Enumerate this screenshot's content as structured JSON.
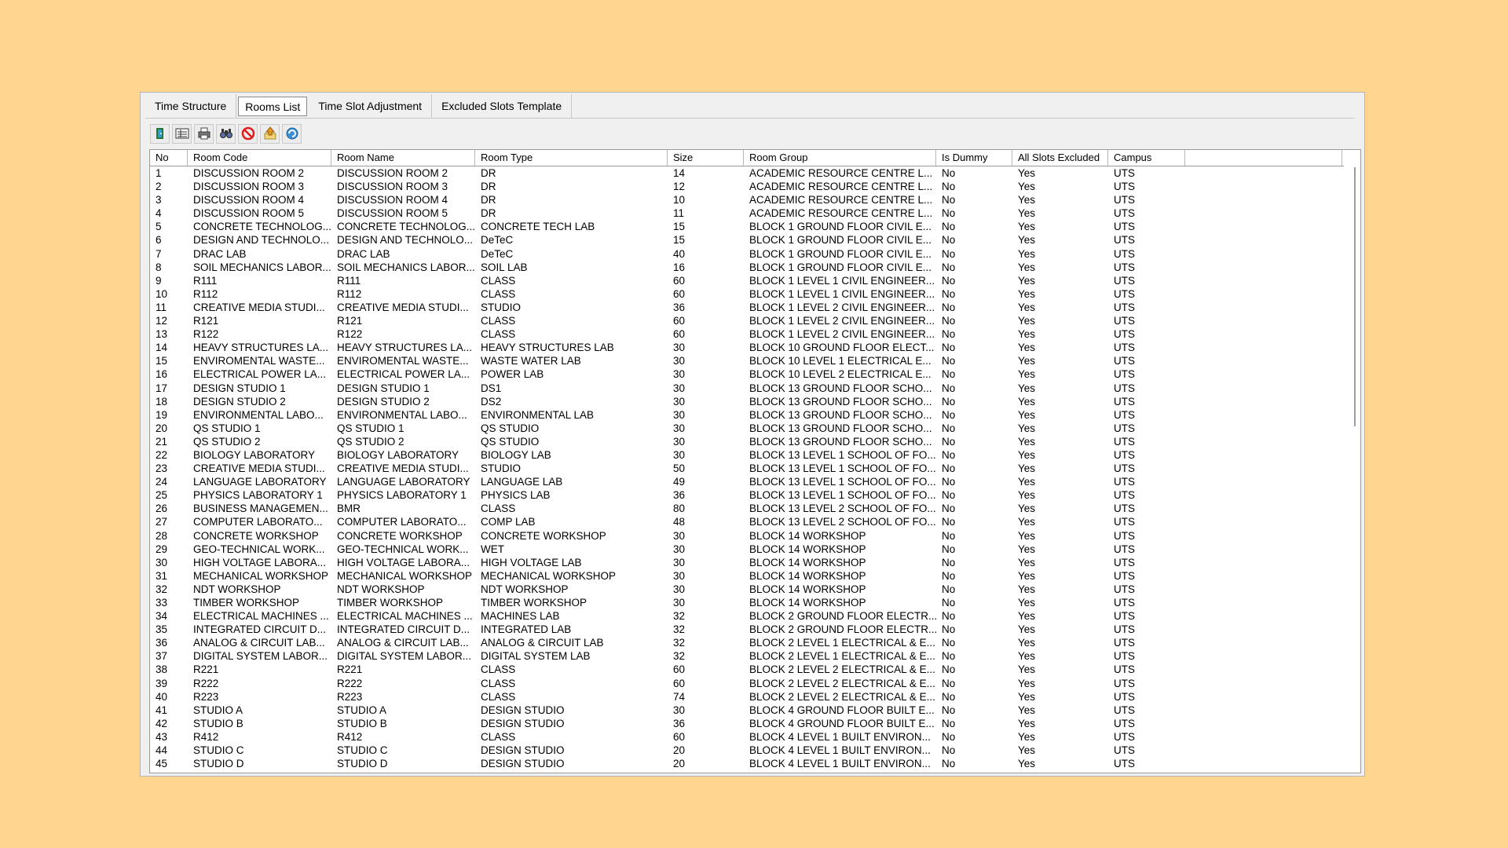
{
  "tabs": [
    {
      "label": "Time Structure"
    },
    {
      "label": "Rooms List"
    },
    {
      "label": "Time Slot Adjustment"
    },
    {
      "label": "Excluded Slots Template"
    }
  ],
  "active_tab": "Rooms List",
  "toolbar": [
    {
      "icon": "exit-door-icon"
    },
    {
      "icon": "list-view-icon"
    },
    {
      "icon": "print-icon"
    },
    {
      "icon": "search-icon"
    },
    {
      "icon": "cancel-icon"
    },
    {
      "icon": "export-icon"
    },
    {
      "icon": "refresh-icon"
    }
  ],
  "table": {
    "columns": [
      "No",
      "Room Code",
      "Room Name",
      "Room Type",
      "Size",
      "Room Group",
      "Is Dummy",
      "All Slots Excluded",
      "Campus",
      ""
    ],
    "rows": [
      [
        "1",
        "DISCUSSION ROOM 2",
        "DISCUSSION ROOM 2",
        "DR",
        "14",
        "ACADEMIC RESOURCE CENTRE L...",
        "No",
        "Yes",
        "UTS"
      ],
      [
        "2",
        "DISCUSSION ROOM 3",
        "DISCUSSION ROOM 3",
        "DR",
        "12",
        "ACADEMIC RESOURCE CENTRE L...",
        "No",
        "Yes",
        "UTS"
      ],
      [
        "3",
        "DISCUSSION ROOM 4",
        "DISCUSSION ROOM 4",
        "DR",
        "10",
        "ACADEMIC RESOURCE CENTRE L...",
        "No",
        "Yes",
        "UTS"
      ],
      [
        "4",
        "DISCUSSION ROOM 5",
        "DISCUSSION ROOM 5",
        "DR",
        "11",
        "ACADEMIC RESOURCE CENTRE L...",
        "No",
        "Yes",
        "UTS"
      ],
      [
        "5",
        "CONCRETE TECHNOLOG...",
        "CONCRETE TECHNOLOG...",
        "CONCRETE TECH LAB",
        "15",
        "BLOCK 1 GROUND FLOOR CIVIL E...",
        "No",
        "Yes",
        "UTS"
      ],
      [
        "6",
        "DESIGN AND TECHNOLO...",
        "DESIGN AND TECHNOLO...",
        "DeTeC",
        "15",
        "BLOCK 1 GROUND FLOOR CIVIL E...",
        "No",
        "Yes",
        "UTS"
      ],
      [
        "7",
        "DRAC LAB",
        "DRAC LAB",
        "DeTeC",
        "40",
        "BLOCK 1 GROUND FLOOR CIVIL E...",
        "No",
        "Yes",
        "UTS"
      ],
      [
        "8",
        "SOIL MECHANICS LABOR...",
        "SOIL MECHANICS LABOR...",
        "SOIL LAB",
        "16",
        "BLOCK 1 GROUND FLOOR CIVIL E...",
        "No",
        "Yes",
        "UTS"
      ],
      [
        "9",
        "R111",
        "R111",
        "CLASS",
        "60",
        "BLOCK 1 LEVEL 1 CIVIL ENGINEER...",
        "No",
        "Yes",
        "UTS"
      ],
      [
        "10",
        "R112",
        "R112",
        "CLASS",
        "60",
        "BLOCK 1 LEVEL 1 CIVIL ENGINEER...",
        "No",
        "Yes",
        "UTS"
      ],
      [
        "11",
        "CREATIVE MEDIA STUDI...",
        "CREATIVE MEDIA STUDI...",
        "STUDIO",
        "36",
        "BLOCK 1 LEVEL 2 CIVIL ENGINEER...",
        "No",
        "Yes",
        "UTS"
      ],
      [
        "12",
        "R121",
        "R121",
        "CLASS",
        "60",
        "BLOCK 1 LEVEL 2 CIVIL ENGINEER...",
        "No",
        "Yes",
        "UTS"
      ],
      [
        "13",
        "R122",
        "R122",
        "CLASS",
        "60",
        "BLOCK 1 LEVEL 2 CIVIL ENGINEER...",
        "No",
        "Yes",
        "UTS"
      ],
      [
        "14",
        "HEAVY STRUCTURES LA...",
        "HEAVY STRUCTURES LA...",
        "HEAVY STRUCTURES LAB",
        "30",
        "BLOCK 10 GROUND FLOOR ELECT...",
        "No",
        "Yes",
        "UTS"
      ],
      [
        "15",
        "ENVIROMENTAL WASTE...",
        "ENVIROMENTAL WASTE...",
        "WASTE WATER LAB",
        "30",
        "BLOCK 10 LEVEL 1 ELECTRICAL E...",
        "No",
        "Yes",
        "UTS"
      ],
      [
        "16",
        "ELECTRICAL POWER LA...",
        "ELECTRICAL POWER LA...",
        "POWER LAB",
        "30",
        "BLOCK 10 LEVEL 2 ELECTRICAL E...",
        "No",
        "Yes",
        "UTS"
      ],
      [
        "17",
        "DESIGN STUDIO 1",
        "DESIGN STUDIO 1",
        "DS1",
        "30",
        "BLOCK 13 GROUND FLOOR SCHO...",
        "No",
        "Yes",
        "UTS"
      ],
      [
        "18",
        "DESIGN STUDIO 2",
        "DESIGN STUDIO 2",
        "DS2",
        "30",
        "BLOCK 13 GROUND FLOOR SCHO...",
        "No",
        "Yes",
        "UTS"
      ],
      [
        "19",
        "ENVIRONMENTAL LABO...",
        "ENVIRONMENTAL LABO...",
        "ENVIRONMENTAL LAB",
        "30",
        "BLOCK 13 GROUND FLOOR SCHO...",
        "No",
        "Yes",
        "UTS"
      ],
      [
        "20",
        "QS STUDIO 1",
        "QS STUDIO 1",
        "QS STUDIO",
        "30",
        "BLOCK 13 GROUND FLOOR SCHO...",
        "No",
        "Yes",
        "UTS"
      ],
      [
        "21",
        "QS STUDIO 2",
        "QS STUDIO 2",
        "QS STUDIO",
        "30",
        "BLOCK 13 GROUND FLOOR SCHO...",
        "No",
        "Yes",
        "UTS"
      ],
      [
        "22",
        "BIOLOGY LABORATORY",
        "BIOLOGY LABORATORY",
        "BIOLOGY LAB",
        "30",
        "BLOCK 13 LEVEL 1 SCHOOL OF FO...",
        "No",
        "Yes",
        "UTS"
      ],
      [
        "23",
        "CREATIVE MEDIA STUDI...",
        "CREATIVE MEDIA STUDI...",
        "STUDIO",
        "50",
        "BLOCK 13 LEVEL 1 SCHOOL OF FO...",
        "No",
        "Yes",
        "UTS"
      ],
      [
        "24",
        "LANGUAGE LABORATORY",
        "LANGUAGE LABORATORY",
        "LANGUAGE LAB",
        "49",
        "BLOCK 13 LEVEL 1 SCHOOL OF FO...",
        "No",
        "Yes",
        "UTS"
      ],
      [
        "25",
        "PHYSICS LABORATORY 1",
        "PHYSICS LABORATORY 1",
        "PHYSICS LAB",
        "36",
        "BLOCK 13 LEVEL 1 SCHOOL OF FO...",
        "No",
        "Yes",
        "UTS"
      ],
      [
        "26",
        "BUSINESS MANAGEMEN...",
        "BMR",
        "CLASS",
        "80",
        "BLOCK 13 LEVEL 2 SCHOOL OF FO...",
        "No",
        "Yes",
        "UTS"
      ],
      [
        "27",
        "COMPUTER LABORATO...",
        "COMPUTER LABORATO...",
        "COMP LAB",
        "48",
        "BLOCK 13 LEVEL 2 SCHOOL OF FO...",
        "No",
        "Yes",
        "UTS"
      ],
      [
        "28",
        "CONCRETE WORKSHOP",
        "CONCRETE WORKSHOP",
        "CONCRETE WORKSHOP",
        "30",
        "BLOCK 14 WORKSHOP",
        "No",
        "Yes",
        "UTS"
      ],
      [
        "29",
        "GEO-TECHNICAL WORK...",
        "GEO-TECHNICAL WORK...",
        "WET",
        "30",
        "BLOCK 14 WORKSHOP",
        "No",
        "Yes",
        "UTS"
      ],
      [
        "30",
        "HIGH VOLTAGE LABORA...",
        "HIGH VOLTAGE LABORA...",
        "HIGH VOLTAGE LAB",
        "30",
        "BLOCK 14 WORKSHOP",
        "No",
        "Yes",
        "UTS"
      ],
      [
        "31",
        "MECHANICAL WORKSHOP",
        "MECHANICAL WORKSHOP",
        "MECHANICAL WORKSHOP",
        "30",
        "BLOCK 14 WORKSHOP",
        "No",
        "Yes",
        "UTS"
      ],
      [
        "32",
        "NDT WORKSHOP",
        "NDT WORKSHOP",
        "NDT WORKSHOP",
        "30",
        "BLOCK 14 WORKSHOP",
        "No",
        "Yes",
        "UTS"
      ],
      [
        "33",
        "TIMBER WORKSHOP",
        "TIMBER WORKSHOP",
        "TIMBER WORKSHOP",
        "30",
        "BLOCK 14 WORKSHOP",
        "No",
        "Yes",
        "UTS"
      ],
      [
        "34",
        "ELECTRICAL MACHINES ...",
        "ELECTRICAL MACHINES ...",
        "MACHINES LAB",
        "32",
        "BLOCK 2 GROUND FLOOR ELECTR...",
        "No",
        "Yes",
        "UTS"
      ],
      [
        "35",
        "INTEGRATED CIRCUIT D...",
        "INTEGRATED CIRCUIT D...",
        "INTEGRATED LAB",
        "32",
        "BLOCK 2 GROUND FLOOR ELECTR...",
        "No",
        "Yes",
        "UTS"
      ],
      [
        "36",
        "ANALOG & CIRCUIT LAB...",
        "ANALOG & CIRCUIT LAB...",
        "ANALOG & CIRCUIT LAB",
        "32",
        "BLOCK 2 LEVEL 1 ELECTRICAL & E...",
        "No",
        "Yes",
        "UTS"
      ],
      [
        "37",
        "DIGITAL SYSTEM LABOR...",
        "DIGITAL SYSTEM LABOR...",
        "DIGITAL SYSTEM LAB",
        "32",
        "BLOCK 2 LEVEL 1 ELECTRICAL & E...",
        "No",
        "Yes",
        "UTS"
      ],
      [
        "38",
        "R221",
        "R221",
        "CLASS",
        "60",
        "BLOCK 2 LEVEL 2 ELECTRICAL & E...",
        "No",
        "Yes",
        "UTS"
      ],
      [
        "39",
        "R222",
        "R222",
        "CLASS",
        "60",
        "BLOCK 2 LEVEL 2 ELECTRICAL & E...",
        "No",
        "Yes",
        "UTS"
      ],
      [
        "40",
        "R223",
        "R223",
        "CLASS",
        "74",
        "BLOCK 2 LEVEL 2 ELECTRICAL & E...",
        "No",
        "Yes",
        "UTS"
      ],
      [
        "41",
        "STUDIO A",
        "STUDIO A",
        "DESIGN STUDIO",
        "30",
        "BLOCK 4 GROUND FLOOR BUILT E...",
        "No",
        "Yes",
        "UTS"
      ],
      [
        "42",
        "STUDIO B",
        "STUDIO B",
        "DESIGN STUDIO",
        "36",
        "BLOCK 4 GROUND FLOOR BUILT E...",
        "No",
        "Yes",
        "UTS"
      ],
      [
        "43",
        "R412",
        "R412",
        "CLASS",
        "60",
        "BLOCK 4 LEVEL 1 BUILT ENVIRON...",
        "No",
        "Yes",
        "UTS"
      ],
      [
        "44",
        "STUDIO C",
        "STUDIO C",
        "DESIGN STUDIO",
        "20",
        "BLOCK 4 LEVEL 1 BUILT ENVIRON...",
        "No",
        "Yes",
        "UTS"
      ],
      [
        "45",
        "STUDIO D",
        "STUDIO D",
        "DESIGN STUDIO",
        "20",
        "BLOCK 4 LEVEL 1 BUILT ENVIRON...",
        "No",
        "Yes",
        "UTS"
      ]
    ]
  }
}
